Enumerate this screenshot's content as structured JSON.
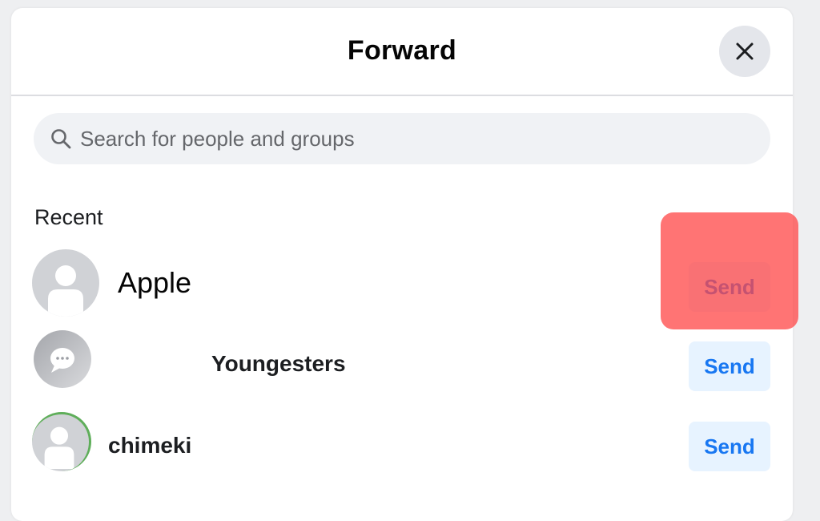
{
  "dialog": {
    "title": "Forward",
    "close_icon": "close-icon"
  },
  "search": {
    "placeholder": "Search for people and groups",
    "icon": "search-icon"
  },
  "recent": {
    "label": "Recent",
    "contacts": [
      {
        "name": "Apple",
        "send_label": "Send",
        "avatar": "default-person-avatar"
      },
      {
        "name": "Youngesters",
        "send_label": "Send",
        "avatar": "group-chat-avatar"
      },
      {
        "name": "chimeki",
        "send_label": "Send",
        "avatar": "default-person-avatar"
      }
    ]
  },
  "colors": {
    "send_text": "#1877f2",
    "send_bg": "#e7f3ff",
    "highlight": "#ff4646"
  }
}
